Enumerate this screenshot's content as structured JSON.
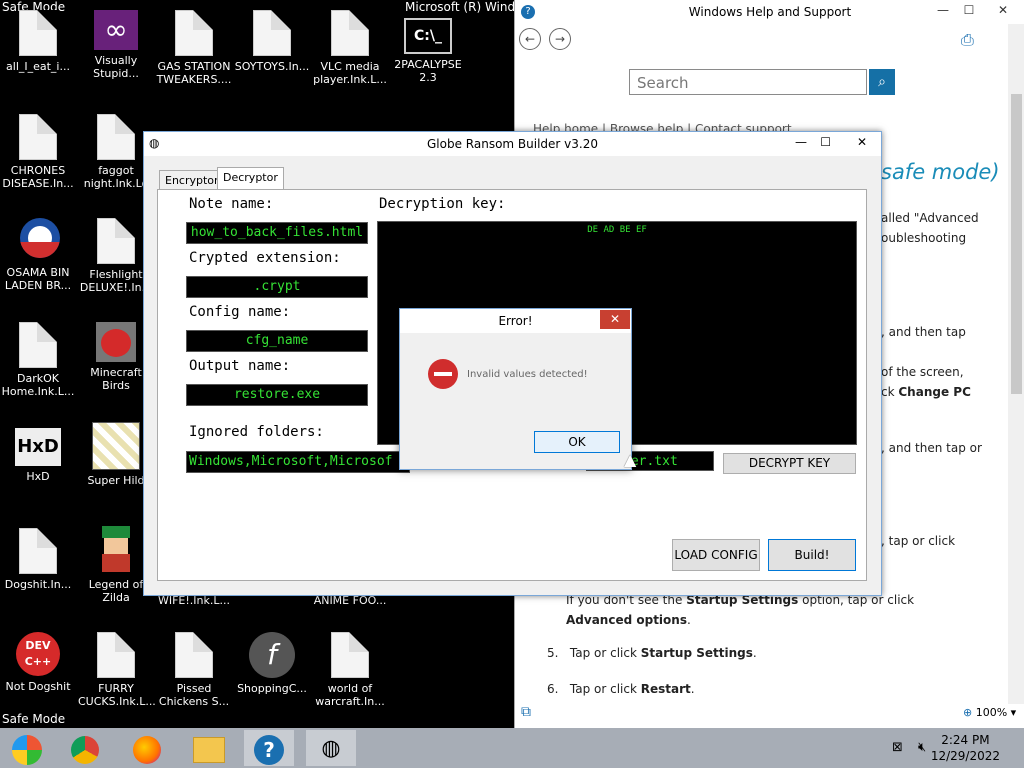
{
  "desktop": {
    "safe_mode_top": "Safe Mode",
    "safe_mode_bottom": "Safe Mode",
    "cmd_window_title": "Microsoft (R) Windo",
    "icons": [
      {
        "label": "all_I_eat_i...",
        "icon": "file-icon"
      },
      {
        "label": "Visually Stupid...",
        "icon": "visual-studio-icon"
      },
      {
        "label": "GAS STATION TWEAKERS....",
        "icon": "file-icon"
      },
      {
        "label": "SOYTOYS.In...",
        "icon": "file-icon"
      },
      {
        "label": "VLC media player.Ink.L...",
        "icon": "file-icon"
      },
      {
        "label": "2PACALYPSE 2.3",
        "icon": "cmd-icon"
      },
      {
        "label": "CHRONES DISEASE.In...",
        "icon": "file-icon"
      },
      {
        "label": "faggot night.Ink.Lo",
        "icon": "file-icon"
      },
      {
        "label": "OSAMA BIN LADEN BR...",
        "icon": "obama-logo-icon"
      },
      {
        "label": "Fleshlight DELUXE!.In...",
        "icon": "file-icon"
      },
      {
        "label": "DarkOK Home.Ink.L...",
        "icon": "file-icon"
      },
      {
        "label": "Minecraft Birds",
        "icon": "angry-birds-icon"
      },
      {
        "label": "HxD",
        "icon": "hxd-icon"
      },
      {
        "label": "Super Hild",
        "icon": "pixel-art-icon"
      },
      {
        "label": "Dogshit.In...",
        "icon": "file-icon"
      },
      {
        "label": "Legend of Zilda",
        "icon": "mario-icon"
      },
      {
        "label": "Not Dogshit",
        "icon": "devcpp-icon"
      },
      {
        "label": "FURRY CUCKS.Ink.L...",
        "icon": "file-icon"
      },
      {
        "label": "Pissed Chickens S...",
        "icon": "file-icon"
      },
      {
        "label": "ShoppingC...",
        "icon": "flash-icon"
      },
      {
        "label": "world of warcraft.In...",
        "icon": "file-icon"
      },
      {
        "label": "WIFE!.Ink.L...",
        "icon": "file-icon"
      },
      {
        "label": "ANIME FOO...",
        "icon": "file-icon"
      }
    ]
  },
  "help_window": {
    "title": "Windows Help and Support",
    "search_placeholder": "Search",
    "links": "Help home | Browse help | Contact support",
    "heading_fragment": "safe mode)",
    "lines": [
      "alled \"Advanced",
      "oubleshooting",
      ", and then tap",
      "of the screen,",
      "ck",
      "Change PC",
      ", and then tap or",
      ", tap or click"
    ],
    "step_startup_a": "If you don't see the",
    "step_startup_b": "Startup Settings",
    "step_startup_c": "option, tap or click",
    "step_startup_d": "Advanced options",
    "step5_num": "5.",
    "step5_a": "Tap or click",
    "step5_b": "Startup Settings",
    "step6_num": "6.",
    "step6_a": "Tap or click",
    "step6_b": "Restart",
    "zoom": "100%"
  },
  "builder": {
    "title": "Globe Ransom Builder v3.20",
    "tabs": [
      "Encryptor",
      "Decryptor"
    ],
    "note_name_label": "Note name:",
    "note_name_value": "how_to_back_files.html",
    "crypted_ext_label": "Crypted extension:",
    "crypted_ext_value": ".crypt",
    "config_name_label": "Config name:",
    "config_name_value": "cfg_name",
    "output_name_label": "Output name:",
    "output_name_value": "restore.exe",
    "ignored_label": "Ignored folders:",
    "ignored_value": "Windows,Microsoft,Microsof",
    "file_field_tail": "ter.txt",
    "decryption_key_label": "Decryption key:",
    "decryption_key_value": "DE AD BE EF",
    "decrypt_button": "DECRYPT KEY",
    "load_config_button": "LOAD CONFIG",
    "build_button": "Build!"
  },
  "dialog": {
    "title": "Error!",
    "message": "Invalid values detected!",
    "ok": "OK"
  },
  "taskbar": {
    "time": "2:24 PM",
    "date": "12/29/2022"
  }
}
